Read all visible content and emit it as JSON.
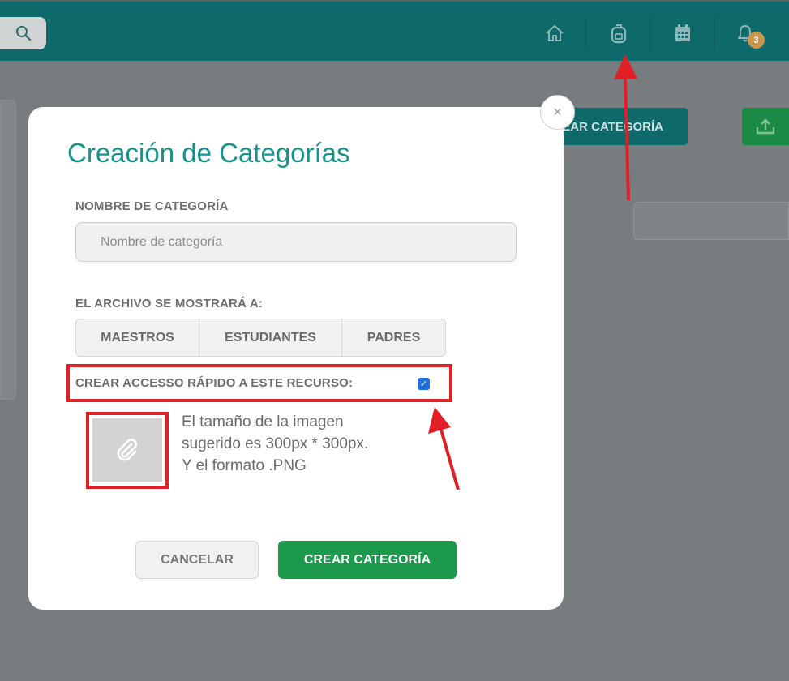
{
  "header": {
    "notification_count": "3",
    "icons": [
      "search-icon",
      "home-icon",
      "backpack-icon",
      "calendar-icon",
      "bell-icon"
    ]
  },
  "background": {
    "create_button_label": "CREAR CATEGORÍA"
  },
  "modal": {
    "title": "Creación de Categorías",
    "close_symbol": "×",
    "name_label": "NOMBRE DE CATEGORÍA",
    "name_placeholder": "Nombre de categoría",
    "name_value": "",
    "audience_label": "EL ARCHIVO SE MOSTRARÁ A:",
    "audience_options": [
      "MAESTROS",
      "ESTUDIANTES",
      "PADRES"
    ],
    "shortcut_label": "CREAR ACCESSO RÁPIDO A ESTE RECURSO:",
    "shortcut_checked": true,
    "image_hint_line1": "El tamaño de la imagen",
    "image_hint_line2": "sugerido es 300px * 300px.",
    "image_hint_line3": "Y el formato .PNG",
    "cancel_label": "CANCELAR",
    "create_label": "CREAR CATEGORÍA"
  },
  "colors": {
    "header": "#0e6a6a",
    "title": "#16938a",
    "primary_button": "#1a9a4a",
    "highlight": "#e11f26",
    "badge": "#c9964b"
  }
}
